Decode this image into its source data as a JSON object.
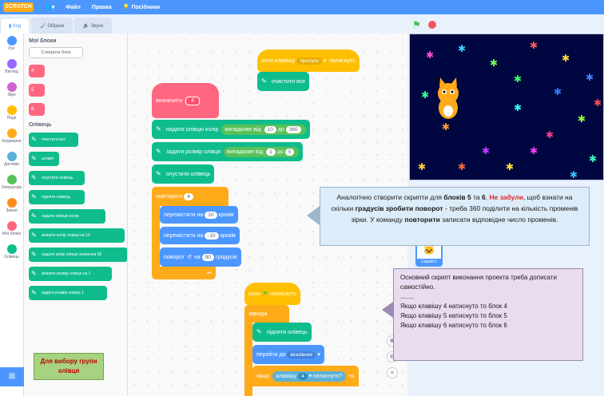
{
  "menubar": {
    "logo": "SCRATCH",
    "file": "Файл",
    "edit": "Правка",
    "tutorials": "Посібники"
  },
  "tabs": {
    "code": "Код",
    "costumes": "Образи",
    "sounds": "Звуки"
  },
  "categories": [
    {
      "label": "Рух",
      "color": "#4c97ff"
    },
    {
      "label": "Вигляд",
      "color": "#9966ff"
    },
    {
      "label": "Звук",
      "color": "#cf63cf"
    },
    {
      "label": "Події",
      "color": "#ffbf00"
    },
    {
      "label": "Керування",
      "color": "#ffab19"
    },
    {
      "label": "Датчики",
      "color": "#5cb1d6"
    },
    {
      "label": "Оператори",
      "color": "#59c059"
    },
    {
      "label": "Змінні",
      "color": "#ff8c1a"
    },
    {
      "label": "Мої блоки",
      "color": "#ff6680"
    },
    {
      "label": "Олівець",
      "color": "#0fbd8c"
    }
  ],
  "palette": {
    "my_blocks_title": "Мої блоки",
    "make_block": "Створити блок",
    "custom": [
      "4",
      "5",
      "6"
    ],
    "pen_title": "Олівець",
    "pen_blocks": [
      "очистити все",
      "штамп",
      "опустити олівець",
      "підняти олівець",
      "надати олівцю колір",
      "змінити колір олівця на 10",
      "надати колір олівця значення 50",
      "змінити розмір олівця на 1",
      "задати розмір олівця 1"
    ]
  },
  "script_define": {
    "define": "визначити",
    "arg": "4",
    "set_color": "надати олівцю колір",
    "random1": "випадкове від",
    "r1a": "10",
    "to": "до",
    "r1b": "360",
    "set_size": "задати розмір олівця",
    "random2": "випадкове від",
    "r2a": "1",
    "r2b": "5",
    "pen_down": "опустити олівець",
    "repeat": "повторити",
    "repeat_n": "4",
    "move1": "перемістити на",
    "move1_n": "10",
    "steps": "кроків",
    "move2": "перемістити на",
    "move2_n": "-10",
    "steps2": "кроків",
    "turn": "поворот",
    "on": "на",
    "turn_n": "90",
    "degrees": "градусів"
  },
  "script_key": {
    "when_key": "коли клавішу",
    "key": "пропуск",
    "pressed": "натиснуто",
    "clear": "очистити все"
  },
  "script_flag": {
    "when": "коли",
    "clicked": "натиснуто",
    "forever": "завжди",
    "pen_up": "підняти олівець",
    "goto": "перейти до",
    "target": "вказівник",
    "if": "якщо",
    "key": "клавішу",
    "key_n": "4",
    "pressed": "натиснуто?",
    "then": "то"
  },
  "sprite": {
    "name": "Спрайт1"
  },
  "tip1": {
    "p1": "Аналогічно створити скрипти для ",
    "b1": "блоків 5",
    "p2": " та ",
    "b2": "6",
    "p3": ". ",
    "red": "Не забули",
    "p4": ", щоб взнати на скільки ",
    "b3": "градусів зробити поворот",
    "p5": " - треба 360 поділити на кількість променів зірки. У команду ",
    "b4": "повторити",
    "p6": " записати відповідне число променів."
  },
  "tip2": {
    "l1": "Основний скрипт виконання проекта треба дописати самостійно.",
    "l2": "........",
    "l3": "Якщо клавішу 4 натиснуто то блок 4",
    "l4": "Якщо клавішу 5 натиснуто то блок 5",
    "l5": "Якщо клавішу 6 натиснуто то блок 6"
  },
  "tip3": {
    "text": "Для вибору групи олівця"
  }
}
